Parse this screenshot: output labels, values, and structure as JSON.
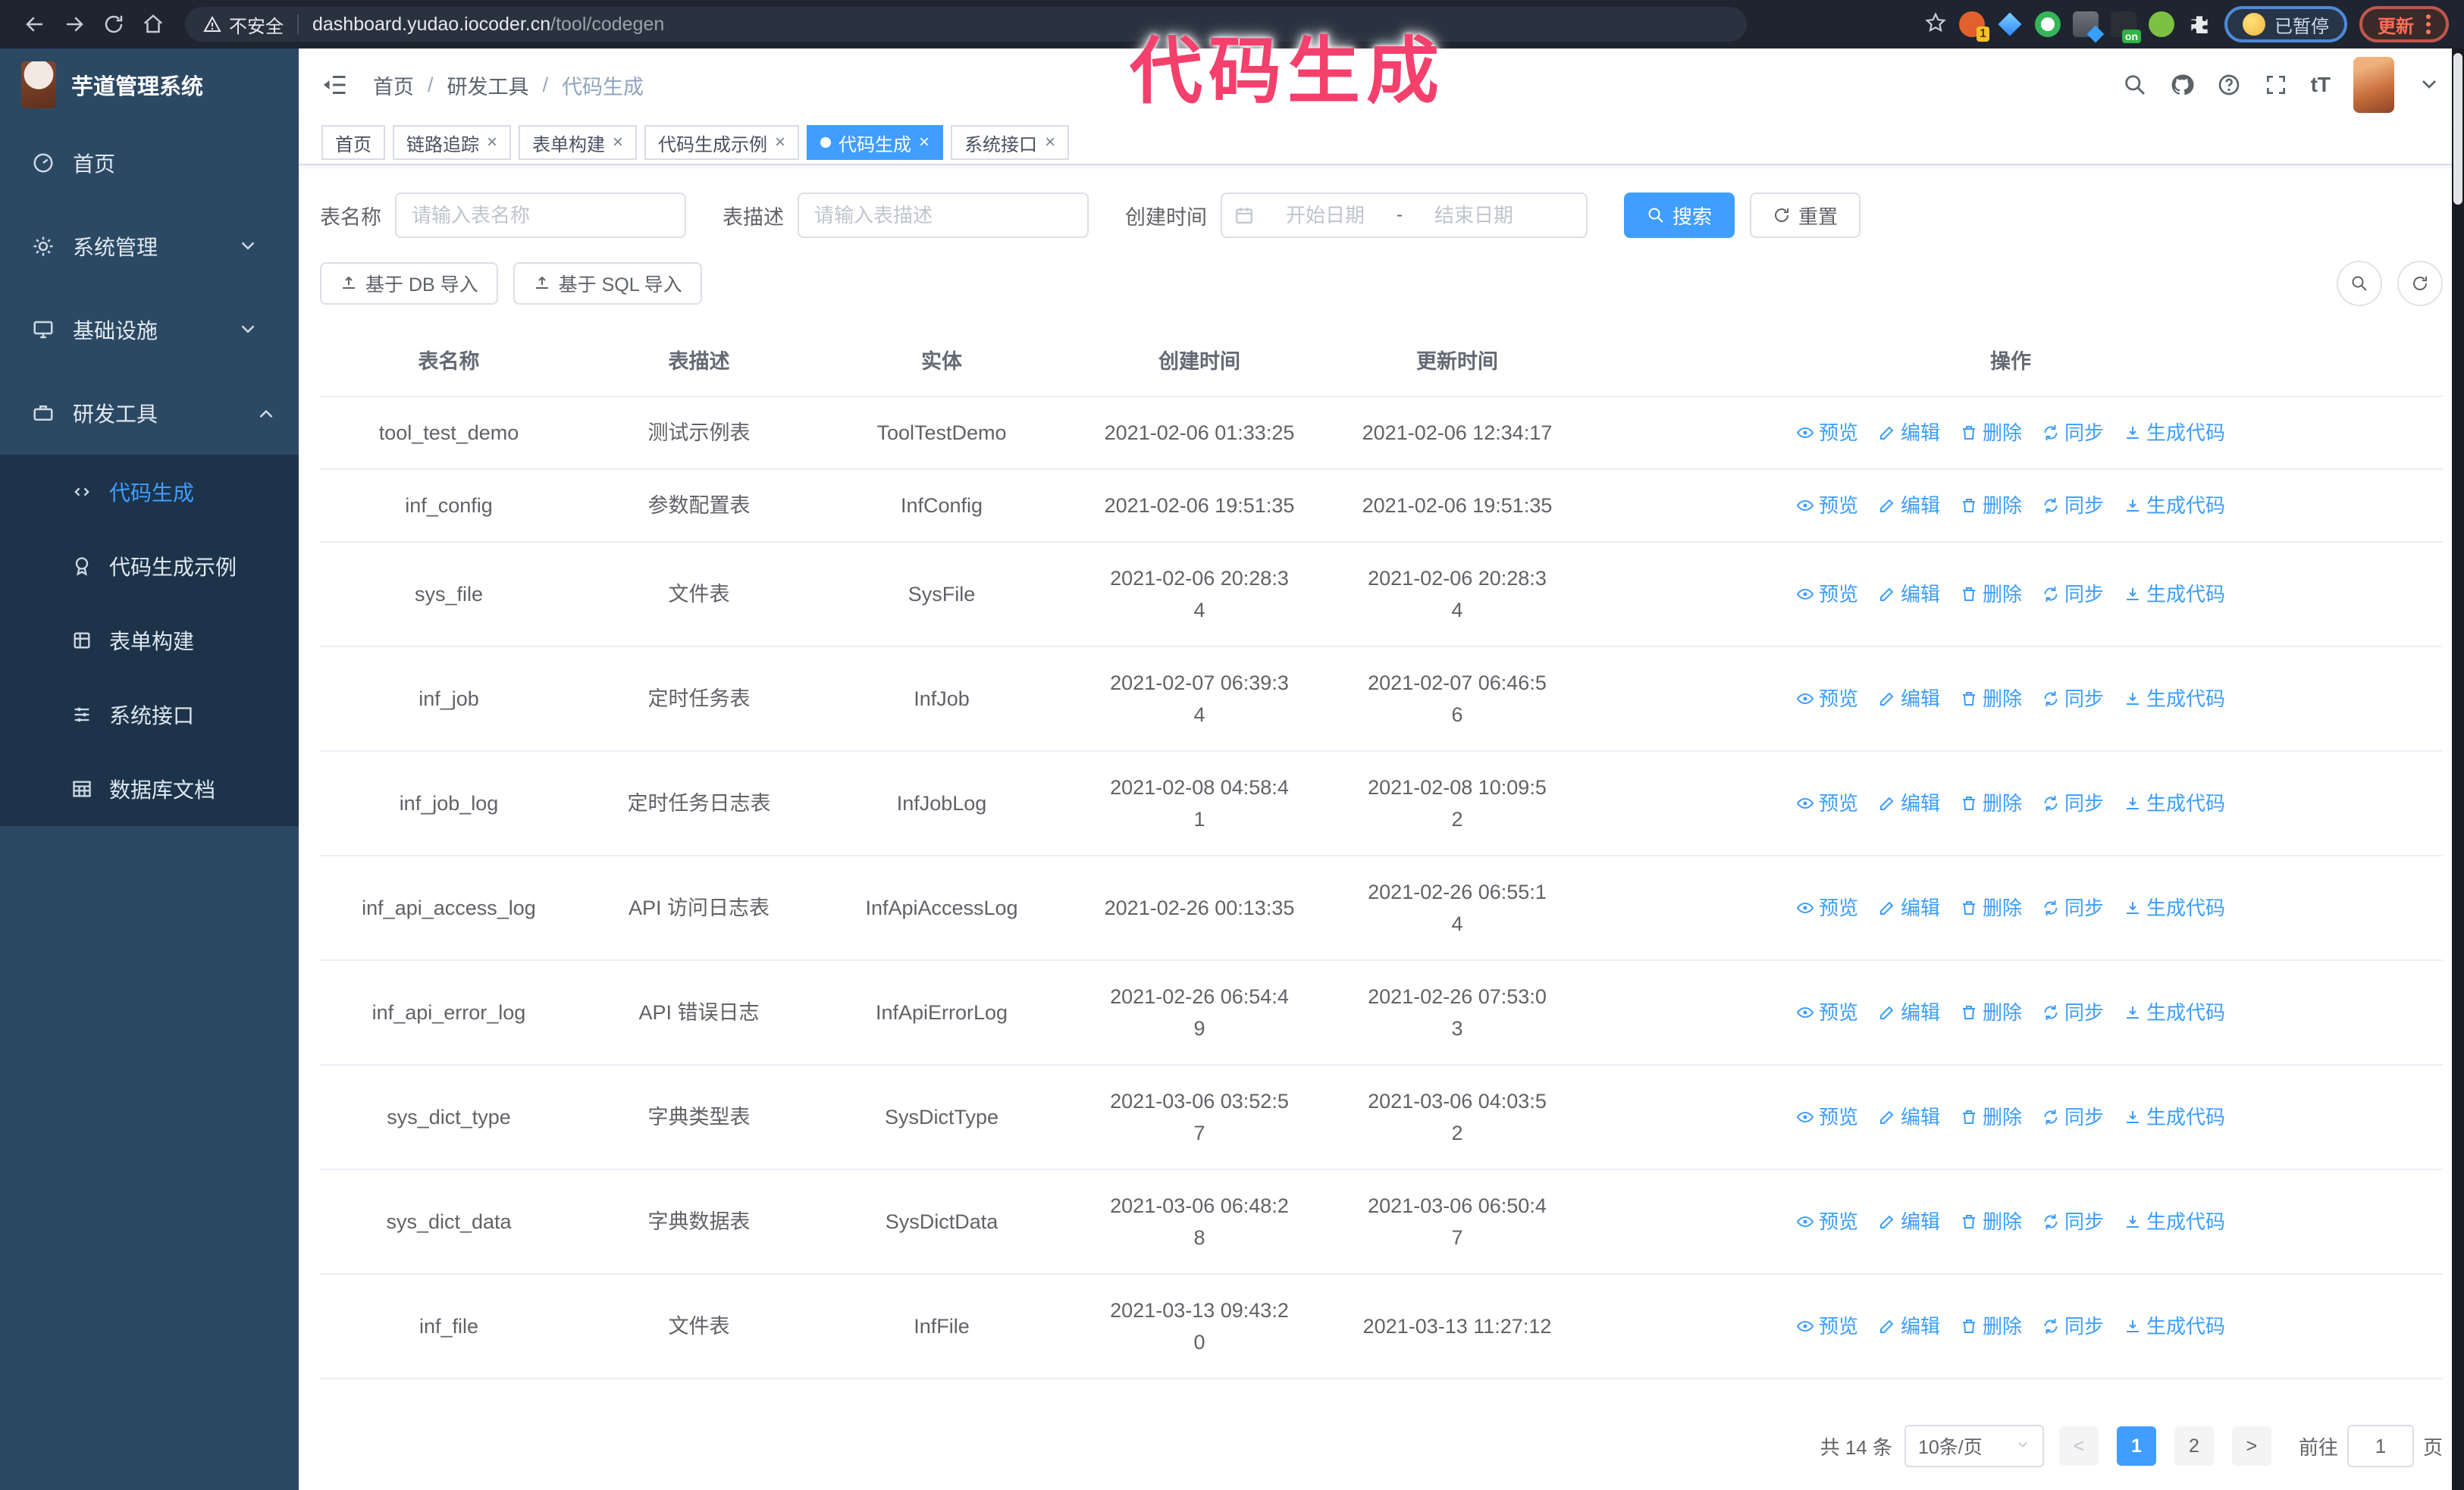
{
  "browser": {
    "security_warning": "不安全",
    "url_host": "dashboard.yudao.iocoder.cn",
    "url_path": "/tool/codegen",
    "extension_badge": "1",
    "extension_on_badge": "on",
    "profile_chip": "已暂停",
    "update_button": "更新"
  },
  "annotation": {
    "text": "代码生成"
  },
  "sidebar": {
    "app_title": "芋道管理系统",
    "items": [
      {
        "label": "首页"
      },
      {
        "label": "系统管理"
      },
      {
        "label": "基础设施"
      },
      {
        "label": "研发工具"
      }
    ],
    "subitems": [
      {
        "label": "代码生成"
      },
      {
        "label": "代码生成示例"
      },
      {
        "label": "表单构建"
      },
      {
        "label": "系统接口"
      },
      {
        "label": "数据库文档"
      }
    ]
  },
  "header": {
    "breadcrumb": [
      "首页",
      "研发工具",
      "代码生成"
    ],
    "font_icon_label": "tT"
  },
  "tabs": [
    {
      "label": "首页"
    },
    {
      "label": "链路追踪"
    },
    {
      "label": "表单构建"
    },
    {
      "label": "代码生成示例"
    },
    {
      "label": "代码生成"
    },
    {
      "label": "系统接口"
    }
  ],
  "filters": {
    "name_label": "表名称",
    "name_placeholder": "请输入表名称",
    "desc_label": "表描述",
    "desc_placeholder": "请输入表描述",
    "time_label": "创建时间",
    "start_placeholder": "开始日期",
    "range_separator": "-",
    "end_placeholder": "结束日期",
    "search_label": "搜索",
    "reset_label": "重置"
  },
  "toolbar": {
    "import_db": "基于 DB 导入",
    "import_sql": "基于 SQL 导入"
  },
  "table": {
    "columns": [
      "表名称",
      "表描述",
      "实体",
      "创建时间",
      "更新时间",
      "操作"
    ],
    "actions": {
      "preview": "预览",
      "edit": "编辑",
      "delete": "删除",
      "sync": "同步",
      "generate": "生成代码"
    },
    "rows": [
      {
        "name": "tool_test_demo",
        "desc": "测试示例表",
        "entity": "ToolTestDemo",
        "created": "2021-02-06 01:33:25",
        "updated": "2021-02-06 12:34:17"
      },
      {
        "name": "inf_config",
        "desc": "参数配置表",
        "entity": "InfConfig",
        "created": "2021-02-06 19:51:35",
        "updated": "2021-02-06 19:51:35"
      },
      {
        "name": "sys_file",
        "desc": "文件表",
        "entity": "SysFile",
        "created": "2021-02-06 20:28:3\n4",
        "updated": "2021-02-06 20:28:3\n4"
      },
      {
        "name": "inf_job",
        "desc": "定时任务表",
        "entity": "InfJob",
        "created": "2021-02-07 06:39:3\n4",
        "updated": "2021-02-07 06:46:5\n6"
      },
      {
        "name": "inf_job_log",
        "desc": "定时任务日志表",
        "entity": "InfJobLog",
        "created": "2021-02-08 04:58:4\n1",
        "updated": "2021-02-08 10:09:5\n2"
      },
      {
        "name": "inf_api_access_log",
        "desc": "API 访问日志表",
        "entity": "InfApiAccessLog",
        "created": "2021-02-26 00:13:35",
        "updated": "2021-02-26 06:55:1\n4"
      },
      {
        "name": "inf_api_error_log",
        "desc": "API 错误日志",
        "entity": "InfApiErrorLog",
        "created": "2021-02-26 06:54:4\n9",
        "updated": "2021-02-26 07:53:0\n3"
      },
      {
        "name": "sys_dict_type",
        "desc": "字典类型表",
        "entity": "SysDictType",
        "created": "2021-03-06 03:52:5\n7",
        "updated": "2021-03-06 04:03:5\n2"
      },
      {
        "name": "sys_dict_data",
        "desc": "字典数据表",
        "entity": "SysDictData",
        "created": "2021-03-06 06:48:2\n8",
        "updated": "2021-03-06 06:50:4\n7"
      },
      {
        "name": "inf_file",
        "desc": "文件表",
        "entity": "InfFile",
        "created": "2021-03-13 09:43:2\n0",
        "updated": "2021-03-13 11:27:12"
      }
    ]
  },
  "pagination": {
    "total": "共 14 条",
    "page_size": "10条/页",
    "pages": [
      "1",
      "2"
    ],
    "goto_label": "前往",
    "goto_value": "1",
    "page_unit": "页"
  },
  "colors": {
    "primary": "#409eff",
    "sidebar_bg": "#2c4964",
    "submenu_bg": "#1d3349",
    "annotation": "#f4406c"
  }
}
